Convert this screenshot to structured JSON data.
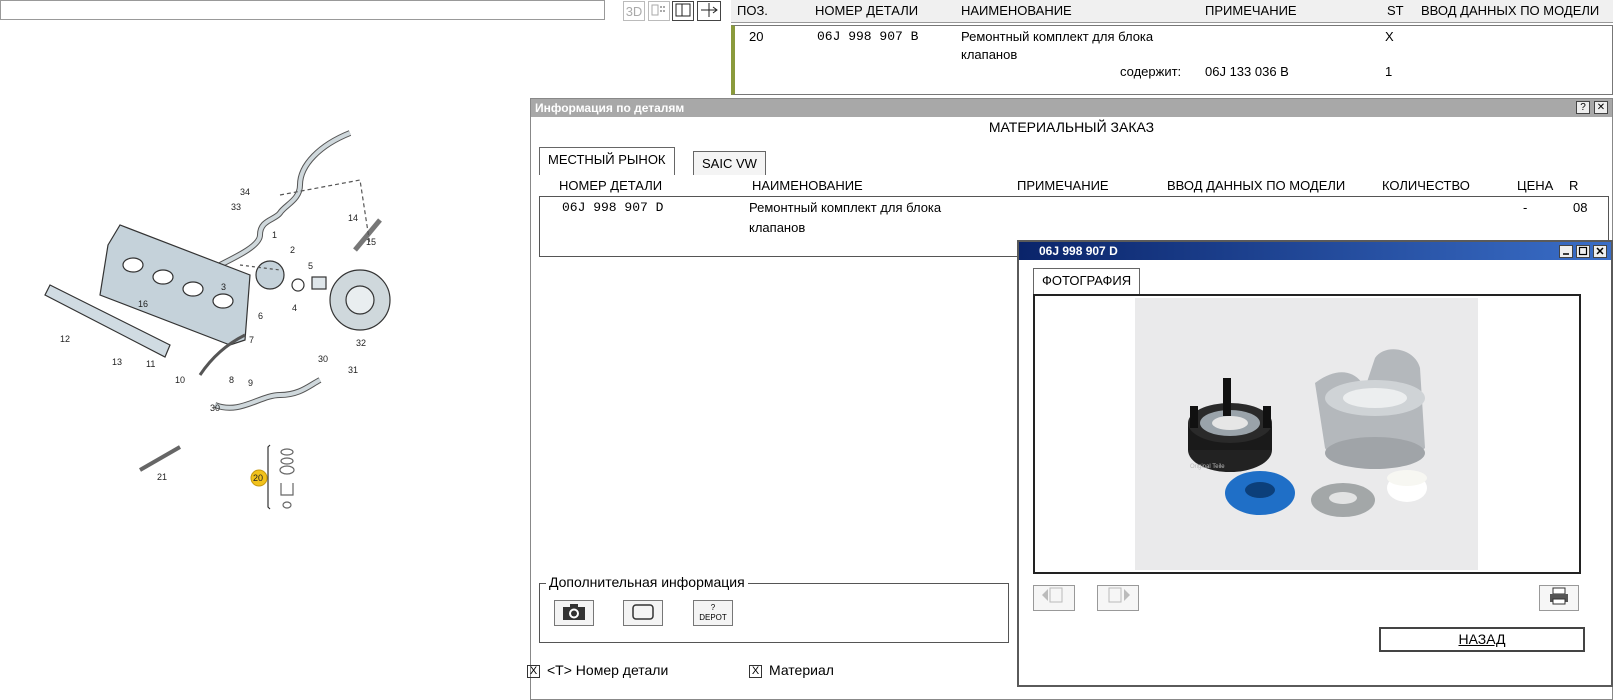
{
  "toolbar": {
    "btn_3d": "3D"
  },
  "top_table": {
    "headers": [
      "ПОЗ.",
      "НОМЕР ДЕТАЛИ",
      "НАИМЕНОВАНИЕ",
      "ПРИМЕЧАНИЕ",
      "ST",
      "ВВОД ДАННЫХ ПО МОДЕЛИ"
    ],
    "row": {
      "pos": "20",
      "part": "06J 998 907 B",
      "name_line1": "Ремонтный комплект для блока",
      "name_line2": "клапанов",
      "st": "X",
      "contains_label": "содержит:",
      "contains_part": "06J 133 036 B",
      "contains_qty": "1"
    }
  },
  "diagram": {
    "labels": [
      "34",
      "33",
      "1",
      "2",
      "3",
      "5",
      "14",
      "15",
      "16",
      "12",
      "13",
      "11",
      "10",
      "8",
      "9",
      "6",
      "7",
      "4",
      "30",
      "31",
      "32",
      "30",
      "21",
      "20"
    ]
  },
  "info_window": {
    "title": "Информация по деталям",
    "help": "?",
    "close": "✕",
    "section_title": "МАТЕРИАЛЬНЫЙ ЗАКАЗ",
    "tabs": [
      "МЕСТНЫЙ РЫНОК",
      "SAIC VW"
    ],
    "headers": [
      "НОМЕР ДЕТАЛИ",
      "НАИМЕНОВАНИЕ",
      "ПРИМЕЧАНИЕ",
      "ВВОД ДАННЫХ ПО МОДЕЛИ",
      "КОЛИЧЕСТВО",
      "ЦЕНА",
      "R"
    ],
    "row": {
      "part": "06J 998 907 D",
      "name_line1": "Ремонтный комплект для блока",
      "name_line2": "клапанов",
      "price": "-",
      "r": "08"
    },
    "additional_info": "Дополнительная информация",
    "depot_q": "?",
    "depot_label": "DEPOT",
    "checkboxes": [
      {
        "label": "<T> Номер детали",
        "mark": "X"
      },
      {
        "label": "Материал",
        "mark": "X"
      }
    ]
  },
  "photo_window": {
    "title": "06J 998 907 D",
    "tab": "ФОТОГРАФИЯ",
    "back_label": "НАЗАД",
    "watermark": "Original Teile"
  }
}
